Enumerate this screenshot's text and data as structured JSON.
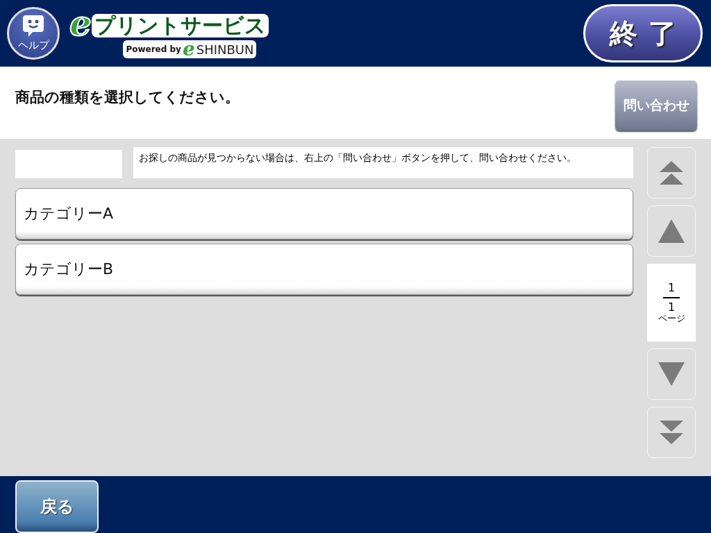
{
  "header": {
    "help_button": {
      "label": "ヘルプ"
    },
    "logo": {
      "mark": "e",
      "title": "プリントサービス",
      "powered_by": "Powered by",
      "brand_mark": "e",
      "brand": "SHINBUN"
    },
    "exit_button": {
      "label": "終了"
    }
  },
  "prompt": {
    "text": "商品の種類を選択してください。",
    "contact_button": {
      "label": "問い合わせ"
    }
  },
  "notice": "お探しの商品が見つからない場合は、右上の「問い合わせ」ボタンを押して、問い合わせください。",
  "categories": [
    {
      "label": "カテゴリーA"
    },
    {
      "label": "カテゴリーB"
    }
  ],
  "pager": {
    "items": [
      {
        "kind": "first"
      },
      {
        "kind": "prev"
      },
      {
        "kind": "indicator",
        "current": "1",
        "total": "1",
        "unit": "ページ"
      },
      {
        "kind": "next"
      },
      {
        "kind": "last"
      }
    ]
  },
  "footer": {
    "back_button": {
      "label": "戻る"
    }
  }
}
